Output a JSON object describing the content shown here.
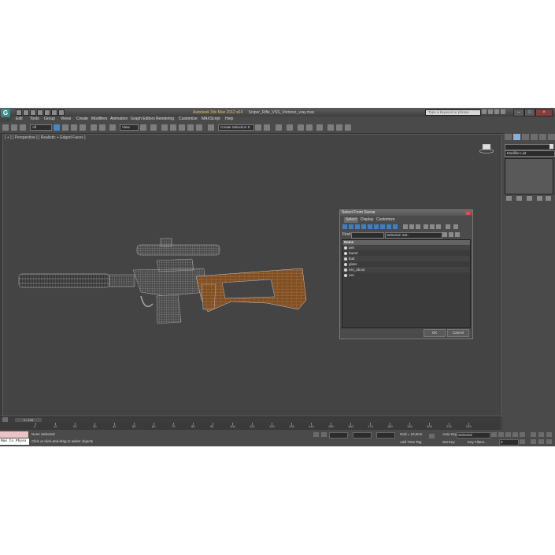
{
  "window": {
    "title": "Autodesk 3ds Max 2012 x64",
    "file": "Sniper_Rifle_VSS_Vintorez_vray.max",
    "search_placeholder": "Type a keyword or phrase"
  },
  "menu": [
    "Edit",
    "Tools",
    "Group",
    "Views",
    "Create",
    "Modifiers",
    "Animation",
    "Graph Editors",
    "Rendering",
    "Customize",
    "MAXScript",
    "Help"
  ],
  "toolbar": {
    "filter_value": "All",
    "view_value": "View",
    "selection_set": "Create Selection S"
  },
  "viewport": {
    "label": "[ + ] [ Perspective ] [ Realistic + Edged Faces ]"
  },
  "command_panel": {
    "modifier_list": "Modifier List"
  },
  "dialog": {
    "title": "Select From Scene",
    "tabs": [
      "Select",
      "Display",
      "Customize"
    ],
    "find_label": "Find:",
    "selection_set_label": "Selection Set:",
    "column_name": "Name",
    "objects": [
      "aim",
      "barrel",
      "butt",
      "glass",
      "vss_about",
      "vss"
    ],
    "ok": "OK",
    "cancel": "Cancel"
  },
  "timeline": {
    "frame": "0 / 225",
    "ticks": [
      "0",
      "10",
      "20",
      "30",
      "40",
      "50",
      "60",
      "70",
      "80",
      "90",
      "100",
      "110",
      "120",
      "130",
      "140",
      "150",
      "160",
      "170",
      "180",
      "190",
      "200",
      "210",
      "220"
    ]
  },
  "status": {
    "listener": "Max to Physx",
    "selection": "None Selected",
    "prompt": "Click or click-and-drag to select objects",
    "grid": "Grid = 10,0cm",
    "add_time_tag": "Add Time Tag",
    "auto_key": "Auto Key",
    "set_key": "Set Key",
    "selected": "Selected",
    "key_filters": "Key Filters...",
    "frame_value": "0"
  },
  "colors": {
    "viewport_bg": "#444444",
    "title_accent": "#e8c36a",
    "wood": "#8a5526",
    "wire": "#9a9a9a"
  }
}
